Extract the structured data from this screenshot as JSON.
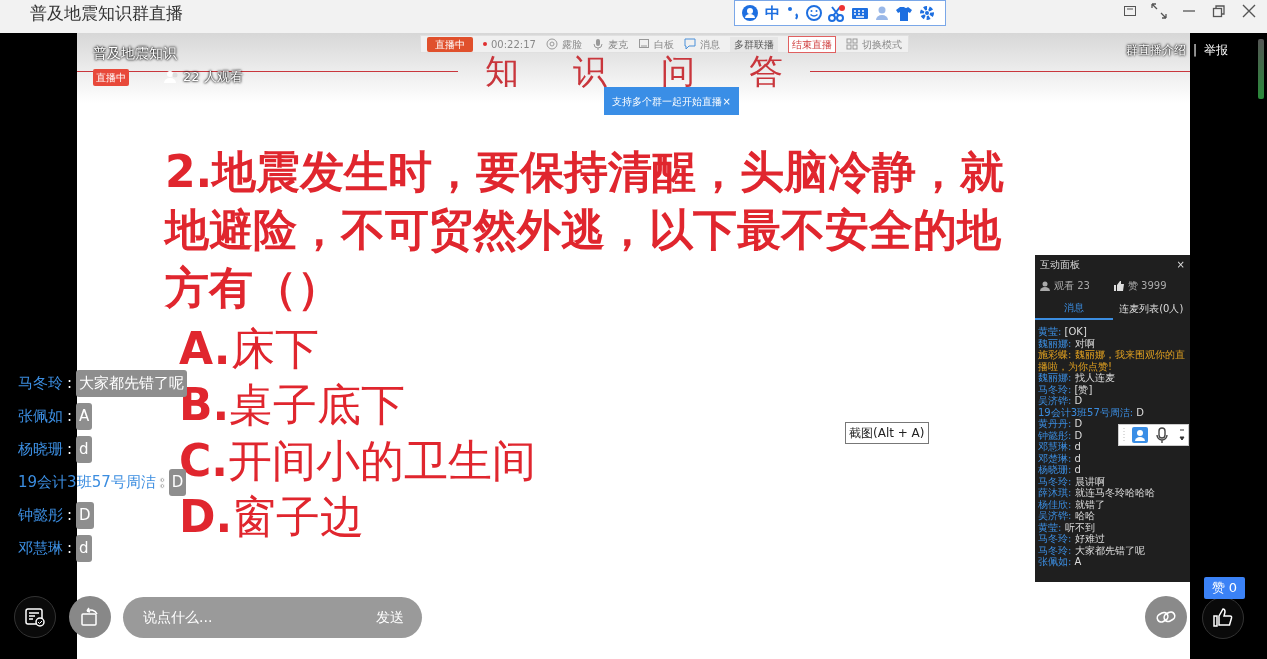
{
  "window": {
    "title": "普及地震知识群直播",
    "ime_mode": "中"
  },
  "overlay_header": {
    "group": "普及地震知识",
    "live_badge": "直播中",
    "viewers": "22 人观看",
    "links": [
      "群直播介绍",
      "举报"
    ],
    "separator": "|"
  },
  "slide_toolbar": {
    "status": "直播中",
    "timer": "00:22:17",
    "tools": [
      {
        "label": "露脸",
        "kind": "camera"
      },
      {
        "label": "麦克",
        "kind": "mic"
      },
      {
        "label": "白板",
        "kind": "board"
      },
      {
        "label": "消息",
        "kind": "message"
      }
    ],
    "multi_group": "多群联播",
    "end_live": "结束直播",
    "switch_mode": "切换模式"
  },
  "popover": {
    "text": "支持多个群一起开始直播",
    "close": "×"
  },
  "slide": {
    "heading": [
      "知",
      "识",
      "问",
      "答"
    ],
    "question": "2.地震发生时，要保持清醒，头脑冷静，就地避险，不可贸然外逃，以下最不安全的地方有（）",
    "options": [
      {
        "letter": "A.",
        "text": "床下"
      },
      {
        "letter": "B.",
        "text": "桌子底下"
      },
      {
        "letter": "C.",
        "text": "开间小的卫生间"
      },
      {
        "letter": "D.",
        "text": "窗子边"
      }
    ]
  },
  "live_chat": [
    {
      "user": "马冬玲",
      "separator": ":",
      "message": "大家都先错了呢"
    },
    {
      "user": "张佩如",
      "separator": ":",
      "message": "A"
    },
    {
      "user": "杨晓珊",
      "separator": ":",
      "message": "d"
    },
    {
      "user": "19会计3班57号周洁",
      "separator": ":",
      "message": "D"
    },
    {
      "user": "钟懿彤",
      "separator": ":",
      "message": "D"
    },
    {
      "user": "邓慧琳",
      "separator": ":",
      "message": "d"
    }
  ],
  "tooltip": "截图(Alt + A)",
  "panel": {
    "title": "互动面板",
    "close": "×",
    "watching": "观看 23",
    "likes": "赞 3999",
    "tabs": [
      {
        "label": "消息",
        "selected": true
      },
      {
        "label": "连麦列表(0人)",
        "selected": false
      }
    ],
    "messages": [
      {
        "user": "黄莹:",
        "text": "[OK]",
        "highlight": false
      },
      {
        "user": "魏丽娜:",
        "text": "对啊",
        "highlight": false
      },
      {
        "user": "施彩蝶:",
        "text": "魏丽娜，我来围观你的直播啦，为你点赞!",
        "highlight": true
      },
      {
        "user": "魏丽娜:",
        "text": "找人连麦",
        "highlight": false
      },
      {
        "user": "马冬玲:",
        "text": "[赞]",
        "highlight": false
      },
      {
        "user": "吴济铧:",
        "text": "D",
        "highlight": false
      },
      {
        "user": "19会计3班57号周洁:",
        "text": "D",
        "highlight": false
      },
      {
        "user": "黄丹丹:",
        "text": "D",
        "highlight": false
      },
      {
        "user": "钟懿彤:",
        "text": "D",
        "highlight": false
      },
      {
        "user": "邓慧琳:",
        "text": "d",
        "highlight": false
      },
      {
        "user": "邓楚琳:",
        "text": "d",
        "highlight": false
      },
      {
        "user": "杨晓珊:",
        "text": "d",
        "highlight": false
      },
      {
        "user": "马冬玲:",
        "text": "晨讲啊",
        "highlight": false
      },
      {
        "user": "薛沐琪:",
        "text": "就连马冬玲哈哈哈",
        "highlight": false
      },
      {
        "user": "杨佳欣:",
        "text": "就错了",
        "highlight": false
      },
      {
        "user": "吴济铧:",
        "text": "哈哈",
        "highlight": false
      },
      {
        "user": "黄莹:",
        "text": "听不到",
        "highlight": false
      },
      {
        "user": "马冬玲:",
        "text": "好难过",
        "highlight": false
      },
      {
        "user": "马冬玲:",
        "text": "大家都先错了呢",
        "highlight": false
      },
      {
        "user": "张佩如:",
        "text": "A",
        "highlight": false
      }
    ]
  },
  "composer": {
    "placeholder": "说点什么...",
    "send": "发送"
  },
  "like_count": "赞 0"
}
